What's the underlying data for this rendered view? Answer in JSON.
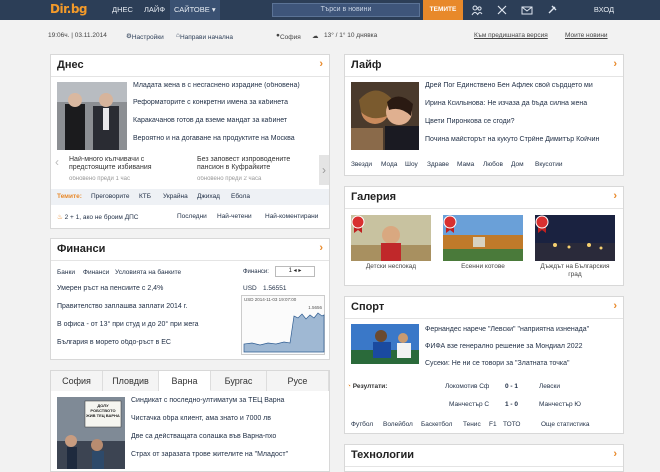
{
  "nav": {
    "logo": "Dir.bg",
    "today": "ДНЕС",
    "life": "ЛАЙФ",
    "sites": "САЙТОВЕ",
    "search_placeholder": "Търси в новини",
    "topics": "ТЕМИТЕ",
    "login": "ВХОД"
  },
  "subbar": {
    "time": "19:06ч. | 03.11.2014",
    "settings": "Настройки",
    "home": "Направи начална",
    "weather": "София",
    "temp": "13° / 1° 10 днявка",
    "prev": "Към предишната версия",
    "my": "Моите новини"
  },
  "today": {
    "title": "Днес",
    "headlines": [
      "Младата жена в с несгаснено израдине (обновена)",
      "Реформаторите с конкретни имена за кабинета",
      "Каракачанов готов да вземе мандат за кабинет",
      "Вероятно и на догаване на продуктите на Москва"
    ],
    "sub1": "Най-много кълчивачи с предстоящите избивания",
    "sub1_time": "обновено преди 1 час",
    "sub2": "Без заповест изпроводените пансион в Куфрайките",
    "sub2_time": "обновено преди 2 часа",
    "themes_label": "Темите:",
    "themes": [
      "Преговорите",
      "КТБ",
      "Украйна",
      "Джихад",
      "Ебола"
    ],
    "poll": "2 + 1, ако не броим ДПС",
    "sort": [
      "Последни",
      "Най-четени",
      "Най-коментирани"
    ]
  },
  "finance": {
    "title": "Финанси",
    "links": [
      "Банки",
      "Финанси",
      "Условията на банките"
    ],
    "headlines": [
      "Умерен ръст на пенсиите с 2,4%",
      "Правителство заплашва заплати 2014 г.",
      "В офиса - от 13° при студ и до 20° при жега",
      "България в морето обдо-ръст в ЕС"
    ],
    "rate_label": "Финанси:",
    "rate_pair": "USD",
    "rate_value": "1.56551",
    "rate_high": "1.5656",
    "chart_caption": "USD 2014-11-03 19:07:00"
  },
  "regions": {
    "tabs": [
      "София",
      "Пловдив",
      "Варна",
      "Бургас",
      "Русе"
    ],
    "headlines": [
      "Синдикат с последно-ултиматум за ТЕЦ Варна",
      "Чистачка обра клиент, ама знато и 7000 лв",
      "Две са действащата солашка във Варна-пхо",
      "Страх от заразата трове жителите на \"Младост\""
    ],
    "sign": "ДОЛУ РОБСТВОТО ЖИВ ТЕЦ ВАРНА"
  },
  "life": {
    "title": "Лайф",
    "headlines": [
      "Дрей Пог Единствено Бен Афлек свой сърдцето ми",
      "Ирина Ксилынова: Не изчаза да бъда силна жена",
      "Цвети Пиронкова се сгоди?",
      "Почина майсторът на кукуто Стрйне Димитър Койчин"
    ],
    "links": [
      "Звезди",
      "Мода",
      "Шоу",
      "Здраве",
      "Мама",
      "Любов",
      "Дом",
      "Вкусотии"
    ]
  },
  "gallery": {
    "title": "Галерия",
    "items": [
      "Детски неспокад",
      "Есенни котове",
      "Дъждът на Българския град"
    ]
  },
  "sport": {
    "title": "Спорт",
    "headlines": [
      "Фернандес нарече \"Левски\" \"наприятна изненада\"",
      "ФИФА взе генерално решение за Мондиал 2022",
      "Сусеки: Не ни се товори за \"Златната точка\""
    ],
    "results_label": "Резултати:",
    "results": [
      {
        "home": "Локомотив Сф",
        "score": "0 - 1",
        "away": "Левски"
      },
      {
        "home": "Манчестър С",
        "score": "1 - 0",
        "away": "Манчестър Ю"
      }
    ],
    "links": [
      "Футбол",
      "Волейбол",
      "Баскетбол",
      "Тенис",
      "F1",
      "ТОТО",
      "Още статистика"
    ]
  },
  "tech": {
    "title": "Технологии"
  },
  "colors": {
    "nav": "#2c3e57",
    "accent": "#e8892a",
    "link": "#1e2d44"
  }
}
